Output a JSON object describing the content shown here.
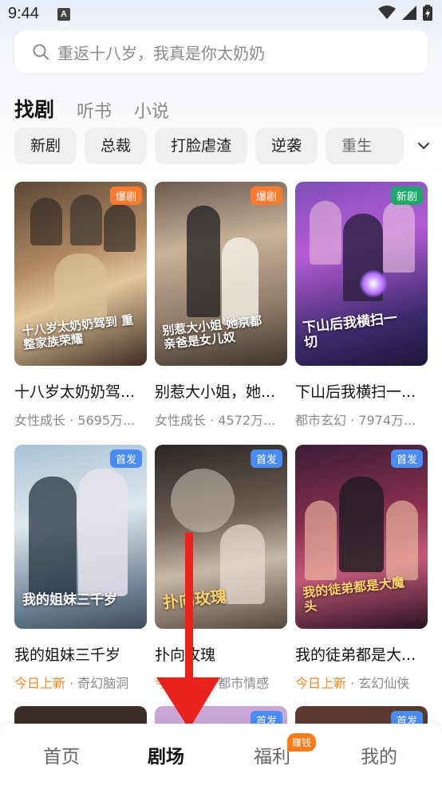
{
  "status": {
    "time": "9:44",
    "notif_letter": "A"
  },
  "search": {
    "placeholder": "重返十八岁，我真是你太奶奶"
  },
  "category_tabs": [
    {
      "label": "找剧",
      "active": true
    },
    {
      "label": "听书",
      "active": false
    },
    {
      "label": "小说",
      "active": false
    }
  ],
  "genre_chips": [
    "新剧",
    "总裁",
    "打脸虐渣",
    "逆袭",
    "重生"
  ],
  "cards": [
    {
      "title": "十八岁太奶奶驾...",
      "genre": "女性成长",
      "plays": "5695万...",
      "badge": "爆剧",
      "badge_type": "hot",
      "poster_text": "十八岁太奶奶驾到 重整家族荣耀",
      "today_new": false
    },
    {
      "title": "别惹大小姐，她...",
      "genre": "女性成长",
      "plays": "4572万...",
      "badge": "爆剧",
      "badge_type": "hot",
      "poster_text": "别惹大小姐 她京都亲爸是女儿奴",
      "today_new": false
    },
    {
      "title": "下山后我横扫一...",
      "genre": "都市玄幻",
      "plays": "7974万...",
      "badge": "新剧",
      "badge_type": "new",
      "poster_text": "下山后我横扫一切",
      "today_new": false
    },
    {
      "title": "我的姐妹三千岁",
      "genre": "奇幻脑洞",
      "plays": "",
      "badge": "首发",
      "badge_type": "first",
      "poster_text": "我的姐妹三千岁",
      "today_new": true
    },
    {
      "title": "扑向玫瑰",
      "genre": "都市情感",
      "plays": "",
      "badge": "首发",
      "badge_type": "first",
      "poster_text": "扑向玫瑰",
      "today_new": true
    },
    {
      "title": "我的徒弟都是大...",
      "genre": "玄幻仙侠",
      "plays": "",
      "badge": "首发",
      "badge_type": "first",
      "poster_text": "我的徒弟都是大魔头",
      "today_new": true
    }
  ],
  "labels": {
    "today_new": "今日上新",
    "dot": " · "
  },
  "bottom_nav": {
    "items": [
      {
        "label": "首页",
        "active": false
      },
      {
        "label": "剧场",
        "active": true
      },
      {
        "label": "福利",
        "active": false
      },
      {
        "label": "我的",
        "active": false
      }
    ],
    "earn_badge": "赚钱"
  },
  "colors": {
    "accent_orange": "#ff7a2e",
    "new_green": "#1aa96a",
    "first_blue": "#4a8cf7",
    "arrow_red": "#e8231f"
  },
  "icons": [
    "search-icon",
    "wifi-icon",
    "signal-icon",
    "battery-icon",
    "chevron-down-icon"
  ]
}
